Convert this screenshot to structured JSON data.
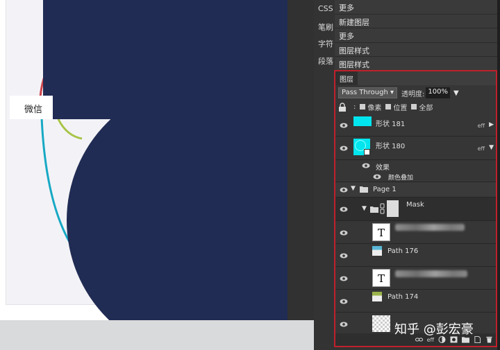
{
  "canvas": {
    "wechat_label": "微信"
  },
  "side_tabs": [
    "CSS",
    "笔刷",
    "字符",
    "段落"
  ],
  "menu": [
    "更多",
    "新建图层",
    "更多",
    "图层样式",
    "图层样式"
  ],
  "layers_panel": {
    "title": "图层",
    "blend_mode": "Pass Through",
    "opacity_label": "透明度:",
    "opacity_value": "100%",
    "lock_options": [
      "像素",
      "位置",
      "全部"
    ],
    "rows": {
      "shape181": {
        "name": "形状 181",
        "eff": "eff"
      },
      "shape180": {
        "name": "形状 180",
        "eff": "eff"
      },
      "effect": "效果",
      "color_overlay": "颜色叠加",
      "group": "Page 1",
      "mask": "Mask",
      "text_thumb": "T",
      "path176": "Path 176",
      "path174": "Path 174"
    },
    "footer_eff": "eff"
  },
  "colors": {
    "accent_border": "#c0202a",
    "navy": "#212c54",
    "cyan": "#00e5ee"
  },
  "watermark": "知乎 @彭宏豪"
}
